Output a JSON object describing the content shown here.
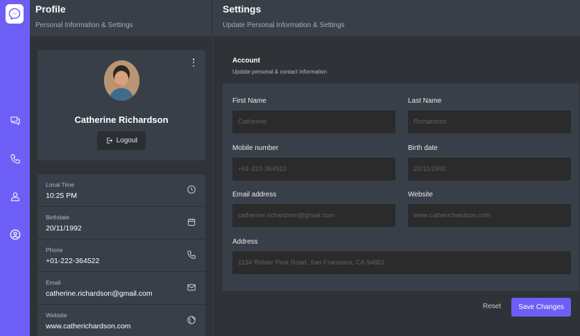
{
  "app": {
    "accent": "#6d5ff5"
  },
  "rail": {
    "items": [
      {
        "icon": "chat-icon"
      },
      {
        "icon": "phone-icon"
      },
      {
        "icon": "contacts-icon"
      },
      {
        "icon": "profile-icon",
        "active": true
      }
    ]
  },
  "profile_panel": {
    "title": "Profile",
    "subtitle": "Personal Information & Settings",
    "name": "Catherine Richardson",
    "logout_label": "Logout",
    "details": [
      {
        "label": "Local Time",
        "value": "10:25 PM",
        "icon": "clock-icon"
      },
      {
        "label": "Birthdate",
        "value": "20/11/1992",
        "icon": "calendar-icon"
      },
      {
        "label": "Phone",
        "value": "+01-222-364522",
        "icon": "phone-icon"
      },
      {
        "label": "Email",
        "value": "catherine.richardson@gmail.com",
        "icon": "mail-icon"
      },
      {
        "label": "Website",
        "value": "www.catherichardson.com",
        "icon": "globe-icon"
      }
    ]
  },
  "settings_panel": {
    "title": "Settings",
    "subtitle": "Update Personal Information & Settings",
    "account": {
      "title": "Account",
      "subtitle": "Update personal & contact information",
      "fields": {
        "first_name": {
          "label": "First Name",
          "placeholder": "Catherine"
        },
        "last_name": {
          "label": "Last Name",
          "placeholder": "Richardson"
        },
        "mobile": {
          "label": "Mobile number",
          "placeholder": "+01-222-364522"
        },
        "birth": {
          "label": "Birth date",
          "placeholder": "20/11/1992"
        },
        "email": {
          "label": "Email address",
          "placeholder": "catherine.richardson@gmail.com"
        },
        "website": {
          "label": "Website",
          "placeholder": "www.catherichardson.com"
        },
        "address": {
          "label": "Address",
          "placeholder": "1134 Ridder Park Road, San Fransisco, CA 94851"
        }
      },
      "reset_label": "Reset",
      "save_label": "Save Changes"
    }
  }
}
